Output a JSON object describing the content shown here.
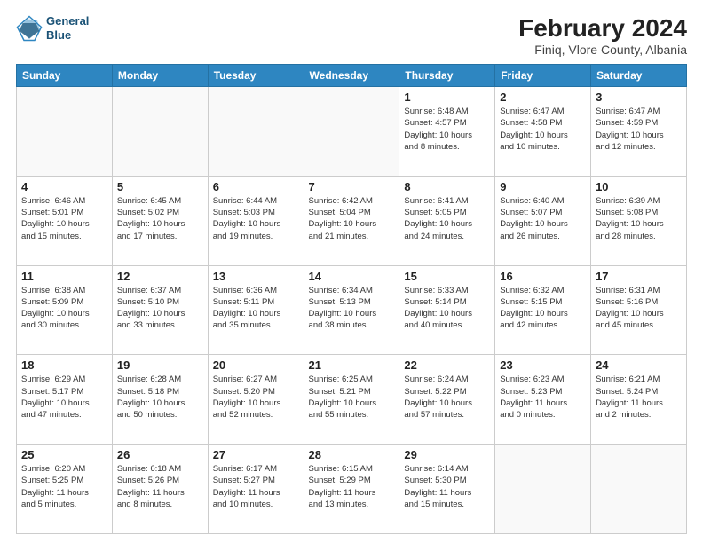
{
  "header": {
    "logo_line1": "General",
    "logo_line2": "Blue",
    "main_title": "February 2024",
    "subtitle": "Finiq, Vlore County, Albania"
  },
  "days_of_week": [
    "Sunday",
    "Monday",
    "Tuesday",
    "Wednesday",
    "Thursday",
    "Friday",
    "Saturday"
  ],
  "weeks": [
    [
      {
        "day": "",
        "info": ""
      },
      {
        "day": "",
        "info": ""
      },
      {
        "day": "",
        "info": ""
      },
      {
        "day": "",
        "info": ""
      },
      {
        "day": "1",
        "info": "Sunrise: 6:48 AM\nSunset: 4:57 PM\nDaylight: 10 hours\nand 8 minutes."
      },
      {
        "day": "2",
        "info": "Sunrise: 6:47 AM\nSunset: 4:58 PM\nDaylight: 10 hours\nand 10 minutes."
      },
      {
        "day": "3",
        "info": "Sunrise: 6:47 AM\nSunset: 4:59 PM\nDaylight: 10 hours\nand 12 minutes."
      }
    ],
    [
      {
        "day": "4",
        "info": "Sunrise: 6:46 AM\nSunset: 5:01 PM\nDaylight: 10 hours\nand 15 minutes."
      },
      {
        "day": "5",
        "info": "Sunrise: 6:45 AM\nSunset: 5:02 PM\nDaylight: 10 hours\nand 17 minutes."
      },
      {
        "day": "6",
        "info": "Sunrise: 6:44 AM\nSunset: 5:03 PM\nDaylight: 10 hours\nand 19 minutes."
      },
      {
        "day": "7",
        "info": "Sunrise: 6:42 AM\nSunset: 5:04 PM\nDaylight: 10 hours\nand 21 minutes."
      },
      {
        "day": "8",
        "info": "Sunrise: 6:41 AM\nSunset: 5:05 PM\nDaylight: 10 hours\nand 24 minutes."
      },
      {
        "day": "9",
        "info": "Sunrise: 6:40 AM\nSunset: 5:07 PM\nDaylight: 10 hours\nand 26 minutes."
      },
      {
        "day": "10",
        "info": "Sunrise: 6:39 AM\nSunset: 5:08 PM\nDaylight: 10 hours\nand 28 minutes."
      }
    ],
    [
      {
        "day": "11",
        "info": "Sunrise: 6:38 AM\nSunset: 5:09 PM\nDaylight: 10 hours\nand 30 minutes."
      },
      {
        "day": "12",
        "info": "Sunrise: 6:37 AM\nSunset: 5:10 PM\nDaylight: 10 hours\nand 33 minutes."
      },
      {
        "day": "13",
        "info": "Sunrise: 6:36 AM\nSunset: 5:11 PM\nDaylight: 10 hours\nand 35 minutes."
      },
      {
        "day": "14",
        "info": "Sunrise: 6:34 AM\nSunset: 5:13 PM\nDaylight: 10 hours\nand 38 minutes."
      },
      {
        "day": "15",
        "info": "Sunrise: 6:33 AM\nSunset: 5:14 PM\nDaylight: 10 hours\nand 40 minutes."
      },
      {
        "day": "16",
        "info": "Sunrise: 6:32 AM\nSunset: 5:15 PM\nDaylight: 10 hours\nand 42 minutes."
      },
      {
        "day": "17",
        "info": "Sunrise: 6:31 AM\nSunset: 5:16 PM\nDaylight: 10 hours\nand 45 minutes."
      }
    ],
    [
      {
        "day": "18",
        "info": "Sunrise: 6:29 AM\nSunset: 5:17 PM\nDaylight: 10 hours\nand 47 minutes."
      },
      {
        "day": "19",
        "info": "Sunrise: 6:28 AM\nSunset: 5:18 PM\nDaylight: 10 hours\nand 50 minutes."
      },
      {
        "day": "20",
        "info": "Sunrise: 6:27 AM\nSunset: 5:20 PM\nDaylight: 10 hours\nand 52 minutes."
      },
      {
        "day": "21",
        "info": "Sunrise: 6:25 AM\nSunset: 5:21 PM\nDaylight: 10 hours\nand 55 minutes."
      },
      {
        "day": "22",
        "info": "Sunrise: 6:24 AM\nSunset: 5:22 PM\nDaylight: 10 hours\nand 57 minutes."
      },
      {
        "day": "23",
        "info": "Sunrise: 6:23 AM\nSunset: 5:23 PM\nDaylight: 11 hours\nand 0 minutes."
      },
      {
        "day": "24",
        "info": "Sunrise: 6:21 AM\nSunset: 5:24 PM\nDaylight: 11 hours\nand 2 minutes."
      }
    ],
    [
      {
        "day": "25",
        "info": "Sunrise: 6:20 AM\nSunset: 5:25 PM\nDaylight: 11 hours\nand 5 minutes."
      },
      {
        "day": "26",
        "info": "Sunrise: 6:18 AM\nSunset: 5:26 PM\nDaylight: 11 hours\nand 8 minutes."
      },
      {
        "day": "27",
        "info": "Sunrise: 6:17 AM\nSunset: 5:27 PM\nDaylight: 11 hours\nand 10 minutes."
      },
      {
        "day": "28",
        "info": "Sunrise: 6:15 AM\nSunset: 5:29 PM\nDaylight: 11 hours\nand 13 minutes."
      },
      {
        "day": "29",
        "info": "Sunrise: 6:14 AM\nSunset: 5:30 PM\nDaylight: 11 hours\nand 15 minutes."
      },
      {
        "day": "",
        "info": ""
      },
      {
        "day": "",
        "info": ""
      }
    ]
  ]
}
